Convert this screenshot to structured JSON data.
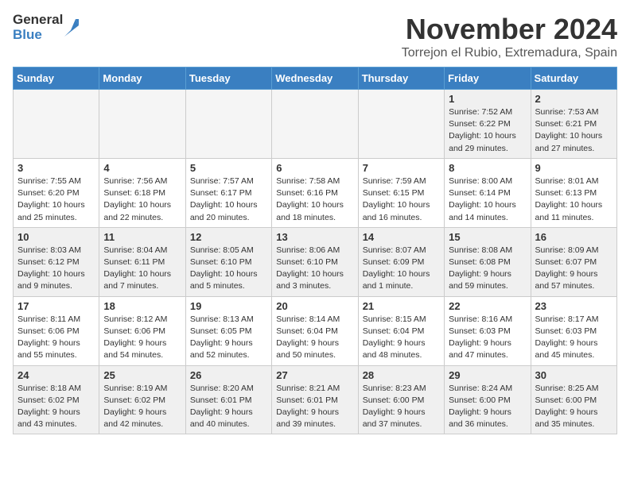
{
  "logo": {
    "general": "General",
    "blue": "Blue"
  },
  "title": "November 2024",
  "location": "Torrejon el Rubio, Extremadura, Spain",
  "headers": [
    "Sunday",
    "Monday",
    "Tuesday",
    "Wednesday",
    "Thursday",
    "Friday",
    "Saturday"
  ],
  "weeks": [
    [
      {
        "day": "",
        "info": "",
        "empty": true
      },
      {
        "day": "",
        "info": "",
        "empty": true
      },
      {
        "day": "",
        "info": "",
        "empty": true
      },
      {
        "day": "",
        "info": "",
        "empty": true
      },
      {
        "day": "",
        "info": "",
        "empty": true
      },
      {
        "day": "1",
        "info": "Sunrise: 7:52 AM\nSunset: 6:22 PM\nDaylight: 10 hours\nand 29 minutes."
      },
      {
        "day": "2",
        "info": "Sunrise: 7:53 AM\nSunset: 6:21 PM\nDaylight: 10 hours\nand 27 minutes."
      }
    ],
    [
      {
        "day": "3",
        "info": "Sunrise: 7:55 AM\nSunset: 6:20 PM\nDaylight: 10 hours\nand 25 minutes."
      },
      {
        "day": "4",
        "info": "Sunrise: 7:56 AM\nSunset: 6:18 PM\nDaylight: 10 hours\nand 22 minutes."
      },
      {
        "day": "5",
        "info": "Sunrise: 7:57 AM\nSunset: 6:17 PM\nDaylight: 10 hours\nand 20 minutes."
      },
      {
        "day": "6",
        "info": "Sunrise: 7:58 AM\nSunset: 6:16 PM\nDaylight: 10 hours\nand 18 minutes."
      },
      {
        "day": "7",
        "info": "Sunrise: 7:59 AM\nSunset: 6:15 PM\nDaylight: 10 hours\nand 16 minutes."
      },
      {
        "day": "8",
        "info": "Sunrise: 8:00 AM\nSunset: 6:14 PM\nDaylight: 10 hours\nand 14 minutes."
      },
      {
        "day": "9",
        "info": "Sunrise: 8:01 AM\nSunset: 6:13 PM\nDaylight: 10 hours\nand 11 minutes."
      }
    ],
    [
      {
        "day": "10",
        "info": "Sunrise: 8:03 AM\nSunset: 6:12 PM\nDaylight: 10 hours\nand 9 minutes."
      },
      {
        "day": "11",
        "info": "Sunrise: 8:04 AM\nSunset: 6:11 PM\nDaylight: 10 hours\nand 7 minutes."
      },
      {
        "day": "12",
        "info": "Sunrise: 8:05 AM\nSunset: 6:10 PM\nDaylight: 10 hours\nand 5 minutes."
      },
      {
        "day": "13",
        "info": "Sunrise: 8:06 AM\nSunset: 6:10 PM\nDaylight: 10 hours\nand 3 minutes."
      },
      {
        "day": "14",
        "info": "Sunrise: 8:07 AM\nSunset: 6:09 PM\nDaylight: 10 hours\nand 1 minute."
      },
      {
        "day": "15",
        "info": "Sunrise: 8:08 AM\nSunset: 6:08 PM\nDaylight: 9 hours\nand 59 minutes."
      },
      {
        "day": "16",
        "info": "Sunrise: 8:09 AM\nSunset: 6:07 PM\nDaylight: 9 hours\nand 57 minutes."
      }
    ],
    [
      {
        "day": "17",
        "info": "Sunrise: 8:11 AM\nSunset: 6:06 PM\nDaylight: 9 hours\nand 55 minutes."
      },
      {
        "day": "18",
        "info": "Sunrise: 8:12 AM\nSunset: 6:06 PM\nDaylight: 9 hours\nand 54 minutes."
      },
      {
        "day": "19",
        "info": "Sunrise: 8:13 AM\nSunset: 6:05 PM\nDaylight: 9 hours\nand 52 minutes."
      },
      {
        "day": "20",
        "info": "Sunrise: 8:14 AM\nSunset: 6:04 PM\nDaylight: 9 hours\nand 50 minutes."
      },
      {
        "day": "21",
        "info": "Sunrise: 8:15 AM\nSunset: 6:04 PM\nDaylight: 9 hours\nand 48 minutes."
      },
      {
        "day": "22",
        "info": "Sunrise: 8:16 AM\nSunset: 6:03 PM\nDaylight: 9 hours\nand 47 minutes."
      },
      {
        "day": "23",
        "info": "Sunrise: 8:17 AM\nSunset: 6:03 PM\nDaylight: 9 hours\nand 45 minutes."
      }
    ],
    [
      {
        "day": "24",
        "info": "Sunrise: 8:18 AM\nSunset: 6:02 PM\nDaylight: 9 hours\nand 43 minutes."
      },
      {
        "day": "25",
        "info": "Sunrise: 8:19 AM\nSunset: 6:02 PM\nDaylight: 9 hours\nand 42 minutes."
      },
      {
        "day": "26",
        "info": "Sunrise: 8:20 AM\nSunset: 6:01 PM\nDaylight: 9 hours\nand 40 minutes."
      },
      {
        "day": "27",
        "info": "Sunrise: 8:21 AM\nSunset: 6:01 PM\nDaylight: 9 hours\nand 39 minutes."
      },
      {
        "day": "28",
        "info": "Sunrise: 8:23 AM\nSunset: 6:00 PM\nDaylight: 9 hours\nand 37 minutes."
      },
      {
        "day": "29",
        "info": "Sunrise: 8:24 AM\nSunset: 6:00 PM\nDaylight: 9 hours\nand 36 minutes."
      },
      {
        "day": "30",
        "info": "Sunrise: 8:25 AM\nSunset: 6:00 PM\nDaylight: 9 hours\nand 35 minutes."
      }
    ]
  ]
}
